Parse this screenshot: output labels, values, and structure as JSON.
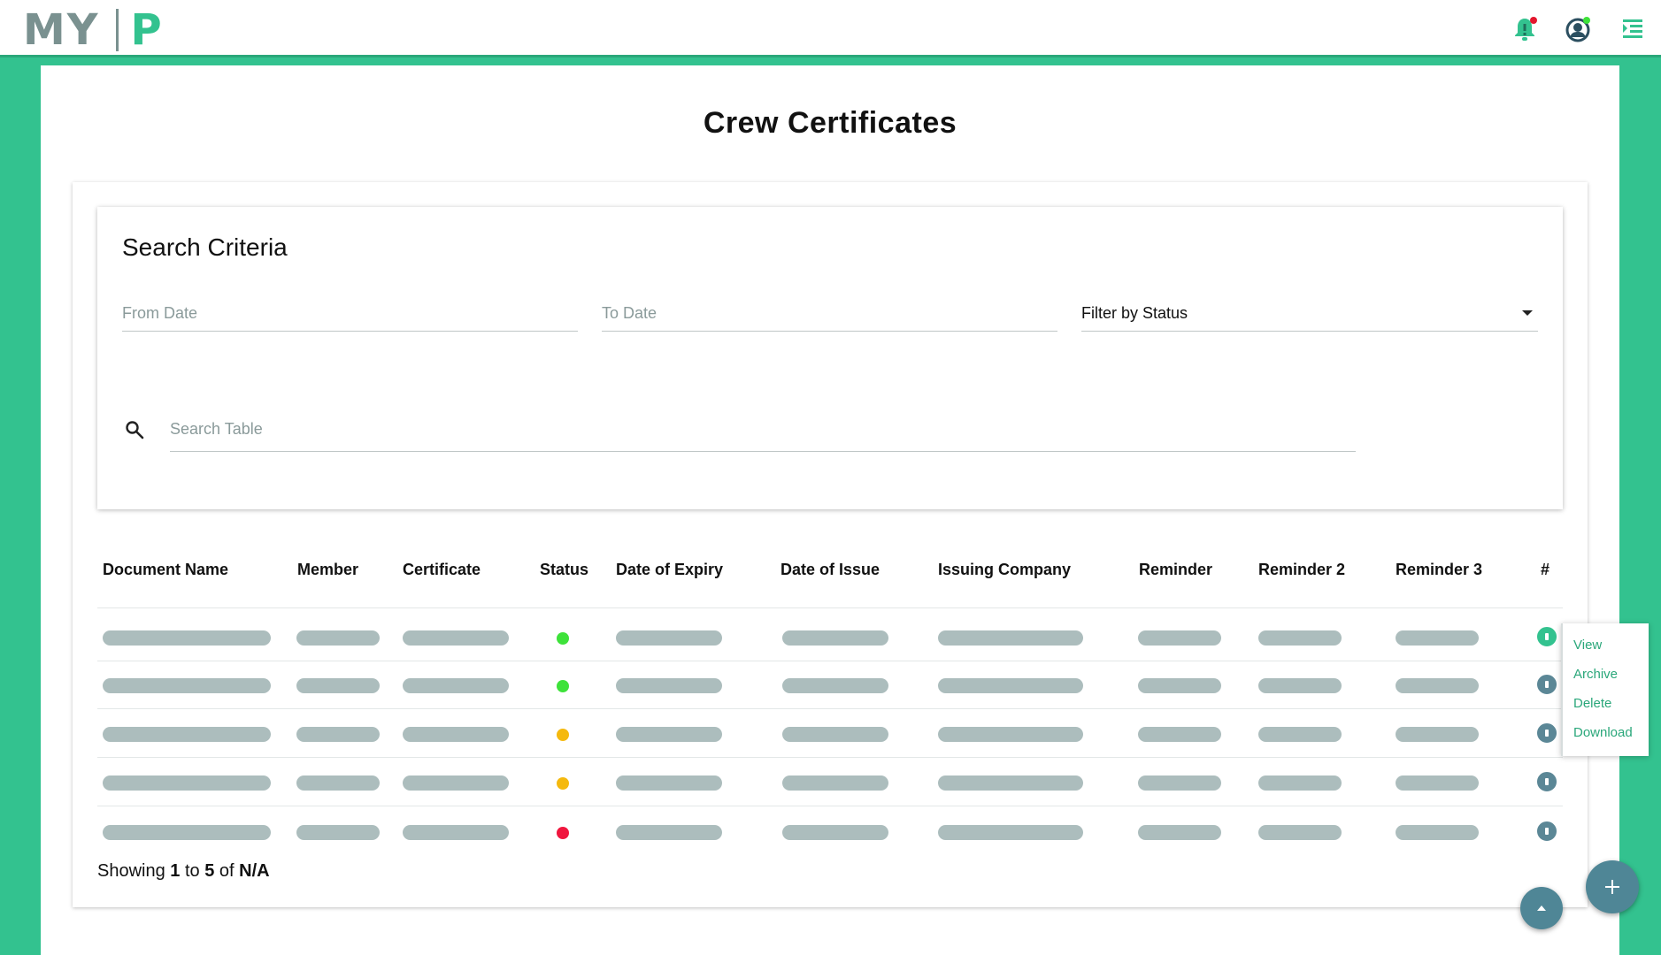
{
  "header": {
    "logo_left": "MY",
    "logo_right": "P",
    "icons": [
      "bell-icon",
      "user-avatar-icon",
      "menu-collapse-icon"
    ]
  },
  "page": {
    "title": "Crew Certificates"
  },
  "search": {
    "title": "Search Criteria",
    "from_date_placeholder": "From Date",
    "to_date_placeholder": "To Date",
    "status_filter_value": "Filter by Status",
    "table_search_placeholder": "Search Table"
  },
  "table": {
    "columns": [
      "Document Name",
      "Member",
      "Certificate",
      "Status",
      "Date of Expiry",
      "Date of Issue",
      "Issuing Company",
      "Reminder",
      "Reminder 2",
      "Reminder 3",
      "#"
    ],
    "rows": [
      {
        "status_color": "#3ee23a"
      },
      {
        "status_color": "#3ee23a"
      },
      {
        "status_color": "#f5b90e"
      },
      {
        "status_color": "#f5b90e"
      },
      {
        "status_color": "#f0163e"
      }
    ]
  },
  "pagination": {
    "prefix": "Showing",
    "from": "1",
    "to_word": "to",
    "to": "5",
    "of_word": "of",
    "total": "N/A"
  },
  "row_menu": {
    "items": [
      "View",
      "Archive",
      "Delete",
      "Download"
    ]
  },
  "colors": {
    "accent": "#33c28f",
    "fab": "#4f8696",
    "skeleton": "#acbdbd"
  }
}
